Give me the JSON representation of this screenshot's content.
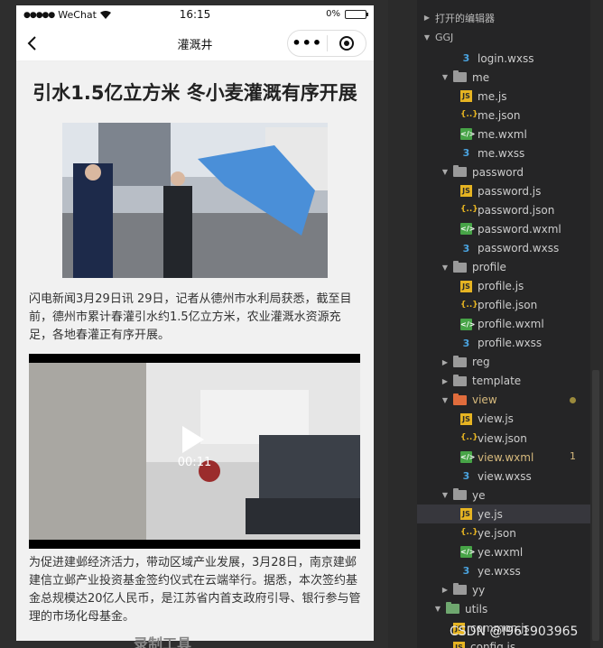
{
  "status_bar": {
    "carrier": "WeChat",
    "time": "16:15",
    "battery": "0%"
  },
  "nav": {
    "title": "灌溉井",
    "more_label": "•••"
  },
  "article": {
    "title": "引水1.5亿立方米 冬小麦灌溉有序开展",
    "paragraph1": "闪电新闻3月29日讯 29日，记者从德州市水利局获悉，截至目前，德州市累计春灌引水约1.5亿立方米，农业灌溉水资源充足，各地春灌正有序开展。",
    "video_duration": "00:11",
    "paragraph2": "为促进建邺经济活力，带动区域产业发展，3月28日，南京建邺建信立邺产业投资基金签约仪式在云端举行。据悉，本次签约基金总规模达20亿人民币，是江苏省内首支政府引导、银行参与管理的市场化母基金。"
  },
  "sim_watermark": "录制工具",
  "explorer": {
    "open_editors": "打开的编辑器",
    "project": "GGJ",
    "rows": [
      {
        "label": "login.wxss",
        "type": "wxss"
      },
      {
        "label": "me",
        "type": "folder"
      },
      {
        "label": "me.js",
        "type": "js"
      },
      {
        "label": "me.json",
        "type": "json"
      },
      {
        "label": "me.wxml",
        "type": "wxml"
      },
      {
        "label": "me.wxss",
        "type": "wxss"
      },
      {
        "label": "password",
        "type": "folder"
      },
      {
        "label": "password.js",
        "type": "js"
      },
      {
        "label": "password.json",
        "type": "json"
      },
      {
        "label": "password.wxml",
        "type": "wxml"
      },
      {
        "label": "password.wxss",
        "type": "wxss"
      },
      {
        "label": "profile",
        "type": "folder"
      },
      {
        "label": "profile.js",
        "type": "js"
      },
      {
        "label": "profile.json",
        "type": "json"
      },
      {
        "label": "profile.wxml",
        "type": "wxml"
      },
      {
        "label": "profile.wxss",
        "type": "wxss"
      },
      {
        "label": "reg",
        "type": "folder"
      },
      {
        "label": "template",
        "type": "folder"
      },
      {
        "label": "view",
        "type": "folder"
      },
      {
        "label": "view.js",
        "type": "js"
      },
      {
        "label": "view.json",
        "type": "json"
      },
      {
        "label": "view.wxml",
        "type": "wxml",
        "badge": "1"
      },
      {
        "label": "view.wxss",
        "type": "wxss"
      },
      {
        "label": "ye",
        "type": "folder"
      },
      {
        "label": "ye.js",
        "type": "js"
      },
      {
        "label": "ye.json",
        "type": "json"
      },
      {
        "label": "ye.wxml",
        "type": "wxml"
      },
      {
        "label": "ye.wxss",
        "type": "wxss"
      },
      {
        "label": "yy",
        "type": "folder"
      },
      {
        "label": "utils",
        "type": "folder"
      },
      {
        "label": "common.js",
        "type": "js"
      },
      {
        "label": "config.js",
        "type": "js"
      }
    ]
  },
  "csdn_watermark": "CSDN @l961903965",
  "colors": {
    "modified": "#d7ba7d",
    "selected_row": "#37373d",
    "view_folder": "#e06c3c"
  }
}
